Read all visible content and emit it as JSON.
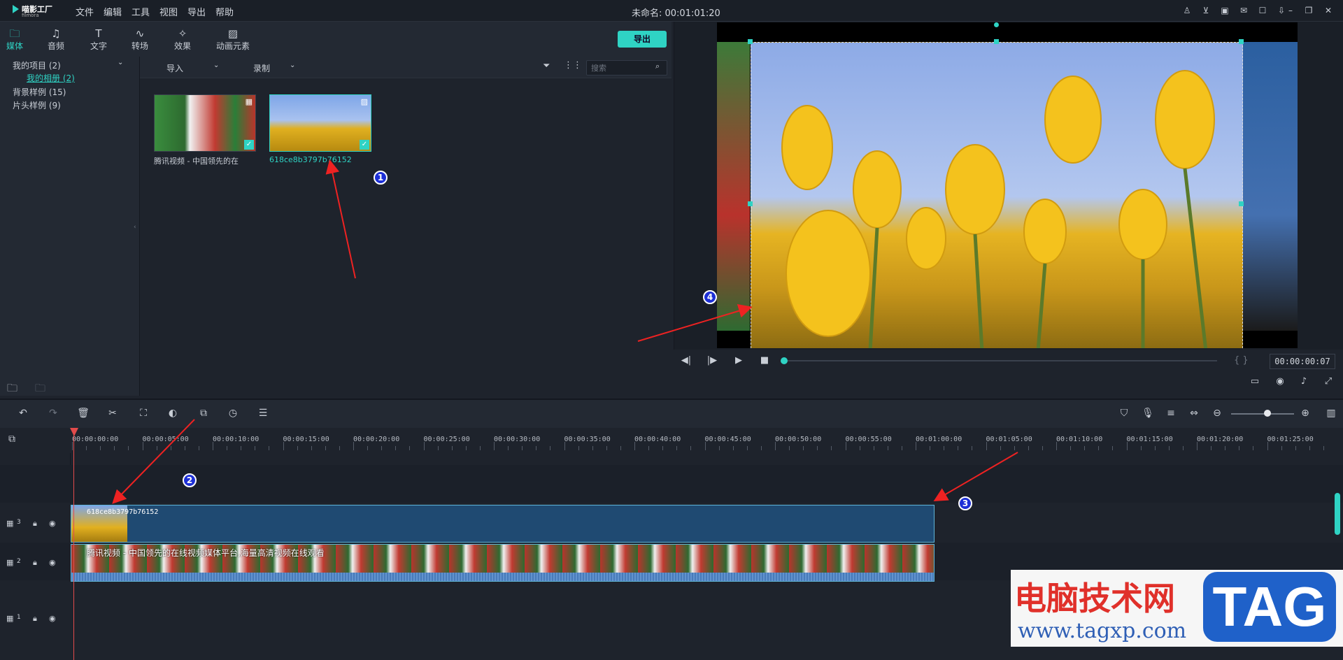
{
  "app": {
    "logo_name": "喵影工厂",
    "logo_sub": "filmora",
    "doc_title": "未命名: 00:01:01:20"
  },
  "menu": [
    "文件",
    "编辑",
    "工具",
    "视图",
    "导出",
    "帮助"
  ],
  "tabs": [
    "媒体",
    "音频",
    "文字",
    "转场",
    "效果",
    "动画元素"
  ],
  "export_label": "导出",
  "library": {
    "project": "我的项目 (2)",
    "album": "我的相册 (2)",
    "bg": "背景样例 (15)",
    "intro": "片头样例 (9)"
  },
  "media_toolbar": {
    "import": "导入",
    "record": "录制",
    "search_placeholder": "搜索"
  },
  "media_items": [
    {
      "caption": "腾讯视频 - 中国领先的在"
    },
    {
      "caption": "618ce8b3797b76152"
    }
  ],
  "preview": {
    "timecode": "00:00:00:07"
  },
  "ruler": [
    "00:00:00:00",
    "00:00:05:00",
    "00:00:10:00",
    "00:00:15:00",
    "00:00:20:00",
    "00:00:25:00",
    "00:00:30:00",
    "00:00:35:00",
    "00:00:40:00",
    "00:00:45:00",
    "00:00:50:00",
    "00:00:55:00",
    "00:01:00:00",
    "00:01:05:00",
    "00:01:10:00",
    "00:01:15:00",
    "00:01:20:00",
    "00:01:25:00"
  ],
  "tracks": [
    "3",
    "2",
    "1"
  ],
  "clips": {
    "image": "618ce8b3797b76152",
    "video": "腾讯视频 - 中国领先的在线视频媒体平台,海量高清视频在线观看"
  },
  "markers": [
    "1",
    "2",
    "3",
    "4"
  ],
  "watermark": {
    "cn": "电脑技术网",
    "url": "www.tagxp.com",
    "tag": "TAG"
  }
}
